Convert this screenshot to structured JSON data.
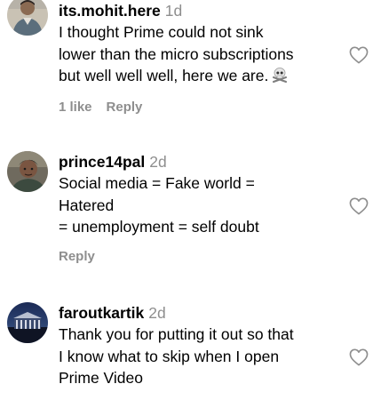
{
  "comments": [
    {
      "username": "its.mohit.here",
      "time": "1d",
      "lines": [
        "I thought Prime could not sink",
        "lower than the micro subscriptions",
        "but well well well, here we are."
      ],
      "emoji": "skull-and-crossbones",
      "likes_label": "1 like",
      "reply_label": "Reply"
    },
    {
      "username": "prince14pal",
      "time": "2d",
      "lines": [
        "Social media = Fake world =",
        "Hatered",
        "= unemployment = self doubt"
      ],
      "reply_label": "Reply"
    },
    {
      "username": "faroutkartik",
      "time": "2d",
      "lines": [
        "Thank you for putting it out so that",
        "I know what to skip when I open",
        "Prime Video"
      ]
    }
  ],
  "icons": {
    "like": "heart-outline-icon"
  },
  "colors": {
    "text": "#000000",
    "secondary": "#8e8e8e",
    "background": "#ffffff"
  }
}
